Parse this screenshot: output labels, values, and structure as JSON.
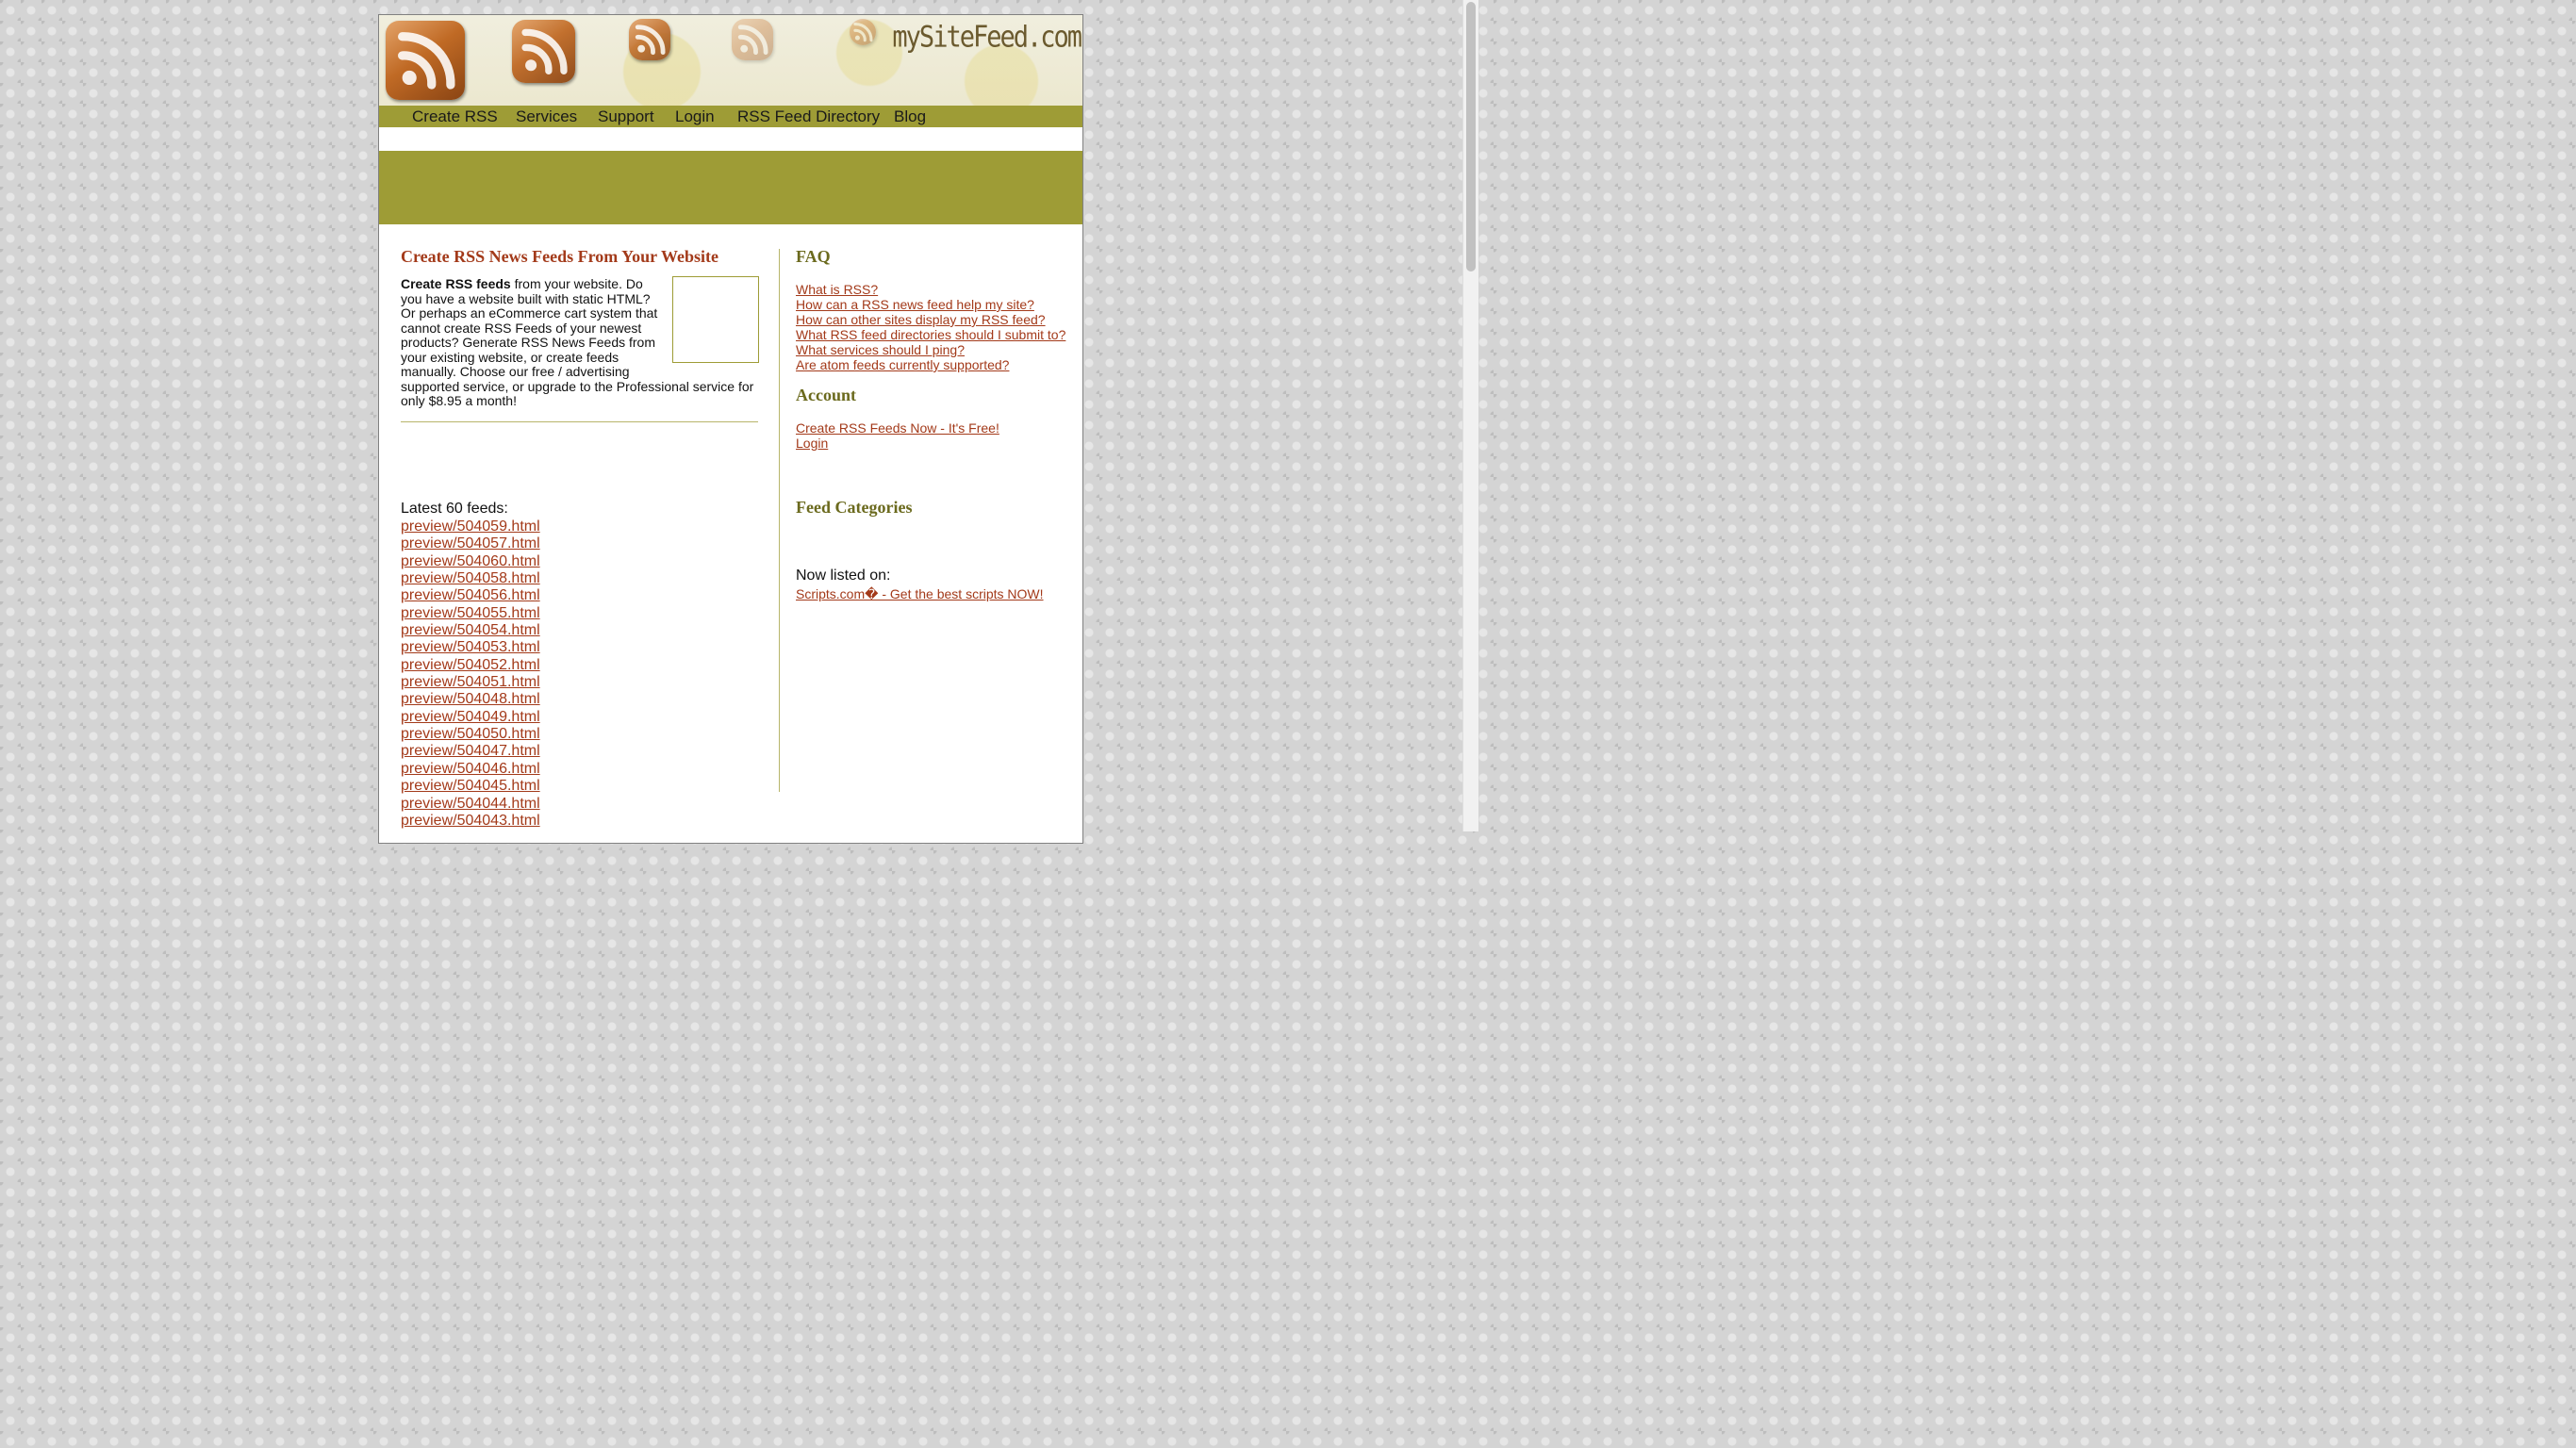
{
  "site": {
    "logo": "mySiteFeed.com"
  },
  "nav": [
    {
      "label": "Create RSS"
    },
    {
      "label": "Services"
    },
    {
      "label": "Support"
    },
    {
      "label": "Login"
    },
    {
      "label": "RSS Feed Directory"
    },
    {
      "label": "Blog"
    }
  ],
  "main": {
    "title": "Create RSS News Feeds From Your Website",
    "intro_bold": "Create RSS feeds",
    "intro_text": " from your website. Do you have a website built with static HTML? Or perhaps an eCommerce cart system that cannot create RSS Feeds of your newest products? Generate RSS News Feeds from your existing website, or create feeds manually. Choose our free / advertising supported service, or upgrade to the Professional service for only $8.95 a month!",
    "latest_label": "Latest 60 feeds:",
    "feeds": [
      "preview/504059.html",
      "preview/504057.html",
      "preview/504060.html",
      "preview/504058.html",
      "preview/504056.html",
      "preview/504055.html",
      "preview/504054.html",
      "preview/504053.html",
      "preview/504052.html",
      "preview/504051.html",
      "preview/504048.html",
      "preview/504049.html",
      "preview/504050.html",
      "preview/504047.html",
      "preview/504046.html",
      "preview/504045.html",
      "preview/504044.html",
      "preview/504043.html"
    ]
  },
  "sidebar": {
    "faq_heading": "FAQ",
    "faq": [
      "What is RSS?",
      "How can a RSS news feed help my site?",
      "How can other sites display my RSS feed?",
      "What RSS feed directories should I submit to?",
      "What services should I ping?",
      "Are atom feeds currently supported?"
    ],
    "account_heading": "Account",
    "account": [
      "Create RSS Feeds Now - It's Free!",
      "Login"
    ],
    "categories_heading": "Feed Categories",
    "now_listed": "Now listed on:",
    "listing_link": "Scripts.com� - Get the best scripts NOW!"
  },
  "colors": {
    "nav_bg": "#9e9c36",
    "link": "#a33a1a",
    "heading": "#a33a1a",
    "side_heading": "#6b6a1e"
  }
}
